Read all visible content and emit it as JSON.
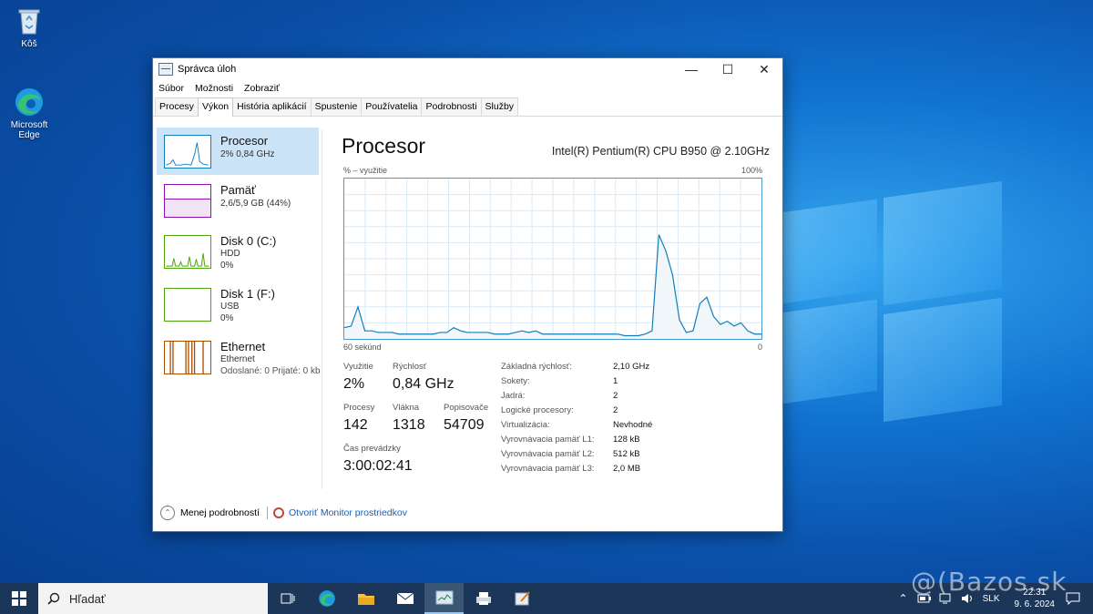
{
  "desktop": {
    "icons": [
      {
        "label": "Kôš",
        "icon": "recycle-bin-icon"
      },
      {
        "label": "Microsoft Edge",
        "icon": "edge-icon"
      }
    ],
    "watermark": "@(Bazos.sk"
  },
  "window": {
    "title": "Správca úloh",
    "controls": {
      "minimize": "—",
      "maximize": "☐",
      "close": "✕"
    },
    "menu": [
      "Súbor",
      "Možnosti",
      "Zobraziť"
    ],
    "tabs": [
      "Procesy",
      "Výkon",
      "História aplikácií",
      "Spustenie",
      "Používatelia",
      "Podrobnosti",
      "Služby"
    ],
    "active_tab": "Výkon"
  },
  "resources": [
    {
      "name": "Procesor",
      "sub1": "2% 0,84 GHz",
      "sub2": "",
      "color": "#117dbb",
      "selected": true
    },
    {
      "name": "Pamäť",
      "sub1": "2,6/5,9 GB (44%)",
      "sub2": "",
      "color": "#8b12ae",
      "selected": false
    },
    {
      "name": "Disk 0 (C:)",
      "sub1": "HDD",
      "sub2": "0%",
      "color": "#4da60c",
      "selected": false
    },
    {
      "name": "Disk 1 (F:)",
      "sub1": "USB",
      "sub2": "0%",
      "color": "#4da60c",
      "selected": false
    },
    {
      "name": "Ethernet",
      "sub1": "Ethernet",
      "sub2": "Odoslané: 0 Prijaté: 0 kb",
      "color": "#a74f01",
      "selected": false
    }
  ],
  "cpu": {
    "title": "Procesor",
    "model": "Intel(R) Pentium(R) CPU B950 @ 2.10GHz",
    "graph_label": "% – využitie",
    "graph_max": "100%",
    "graph_time": "60 sekúnd",
    "graph_min": "0",
    "stats": {
      "usage_label": "Využitie",
      "usage": "2%",
      "speed_label": "Rýchlosť",
      "speed": "0,84 GHz",
      "proc_label": "Procesy",
      "proc": "142",
      "threads_label": "Vlákna",
      "threads": "1318",
      "handles_label": "Popisovače",
      "handles": "54709",
      "uptime_label": "Čas prevádzky",
      "uptime": "3:00:02:41"
    },
    "specs": [
      {
        "label": "Základná rýchlosť:",
        "value": "2,10 GHz"
      },
      {
        "label": "Sokety:",
        "value": "1"
      },
      {
        "label": "Jadrá:",
        "value": "2"
      },
      {
        "label": "Logické procesory:",
        "value": "2"
      },
      {
        "label": "Virtualizácia:",
        "value": "Nevhodné"
      },
      {
        "label": "Vyrovnávacia pamäť L1:",
        "value": "128 kB"
      },
      {
        "label": "Vyrovnávacia pamäť L2:",
        "value": "512 kB"
      },
      {
        "label": "Vyrovnávacia pamäť L3:",
        "value": "2,0 MB"
      }
    ],
    "history_percent": [
      7,
      8,
      20,
      5,
      5,
      4,
      4,
      4,
      3,
      3,
      3,
      3,
      3,
      3,
      4,
      4,
      7,
      5,
      4,
      4,
      4,
      4,
      3,
      3,
      3,
      4,
      5,
      4,
      5,
      3,
      3,
      3,
      3,
      3,
      3,
      3,
      3,
      3,
      3,
      3,
      3,
      2,
      2,
      2,
      3,
      5,
      65,
      55,
      40,
      12,
      4,
      5,
      22,
      26,
      14,
      9,
      11,
      8,
      10,
      5,
      3,
      3
    ]
  },
  "footer": {
    "less_details": "Menej podrobností",
    "monitor_link": "Otvoriť Monitor prostriedkov"
  },
  "taskbar": {
    "search_placeholder": "Hľadať",
    "language": "SLK",
    "time": "22:31",
    "date": "9. 6. 2024"
  }
}
